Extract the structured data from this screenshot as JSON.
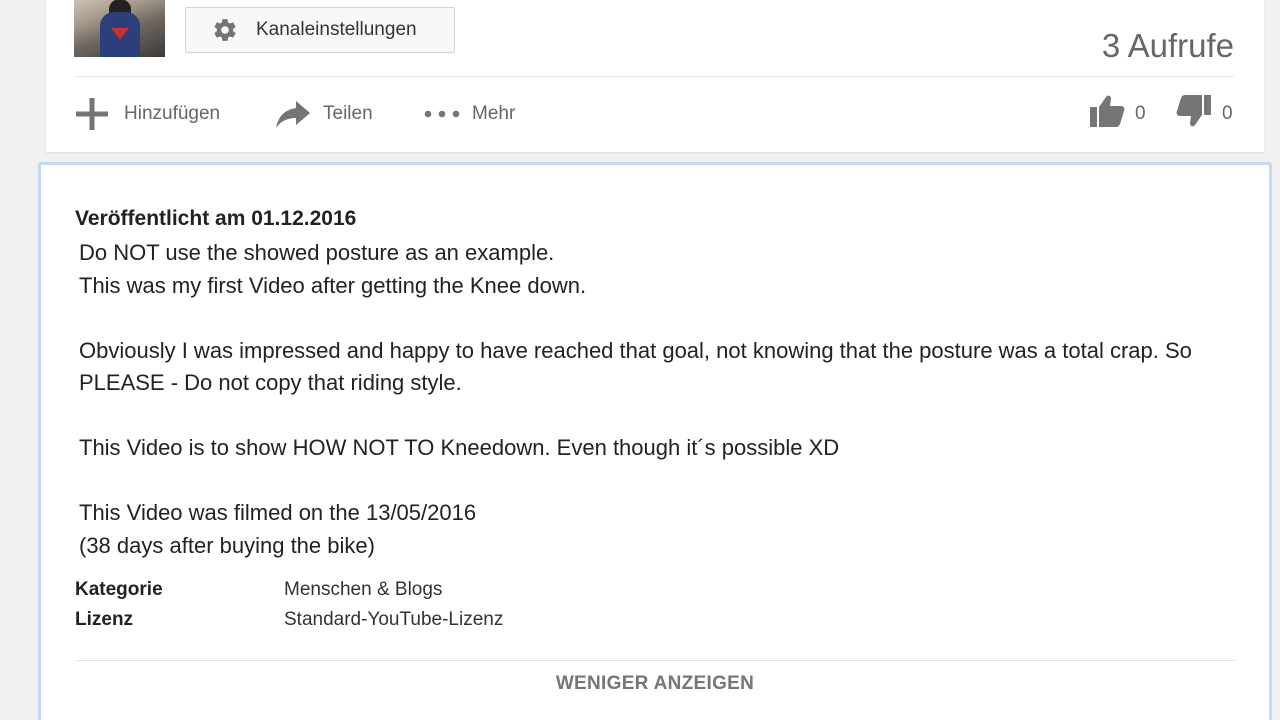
{
  "channel": {
    "settings_label": "Kanaleinstellungen",
    "views": "3 Aufrufe"
  },
  "actions": {
    "add_label": "Hinzufügen",
    "share_label": "Teilen",
    "more_label": "Mehr",
    "like_count": "0",
    "dislike_count": "0"
  },
  "icons": {
    "settings": "gear-icon",
    "add": "plus-icon",
    "share": "share-arrow-icon",
    "more": "ellipsis-icon",
    "like": "thumbs-up-icon",
    "dislike": "thumbs-down-icon"
  },
  "description": {
    "published": "Veröffentlicht am 01.12.2016",
    "paragraphs": [
      "Do NOT use the showed posture as an example.\nThis was my first Video after getting the Knee down.",
      "Obviously I was impressed and happy to have reached that goal, not knowing that the posture was a total crap. So PLEASE - Do not copy that riding style.",
      "This Video is to show HOW NOT TO Kneedown. Even though it´s possible XD",
      "This Video was filmed on the 13/05/2016\n(38 days after buying the bike)"
    ],
    "meta": [
      {
        "key": "Kategorie",
        "value": "Menschen & Blogs"
      },
      {
        "key": "Lizenz",
        "value": "Standard-YouTube-Lizenz"
      }
    ],
    "show_less": "WENIGER ANZEIGEN"
  },
  "colors": {
    "card_border_focus": "#c2daf2",
    "icon_gray": "#757575",
    "page_bg": "#f1f1f1"
  }
}
